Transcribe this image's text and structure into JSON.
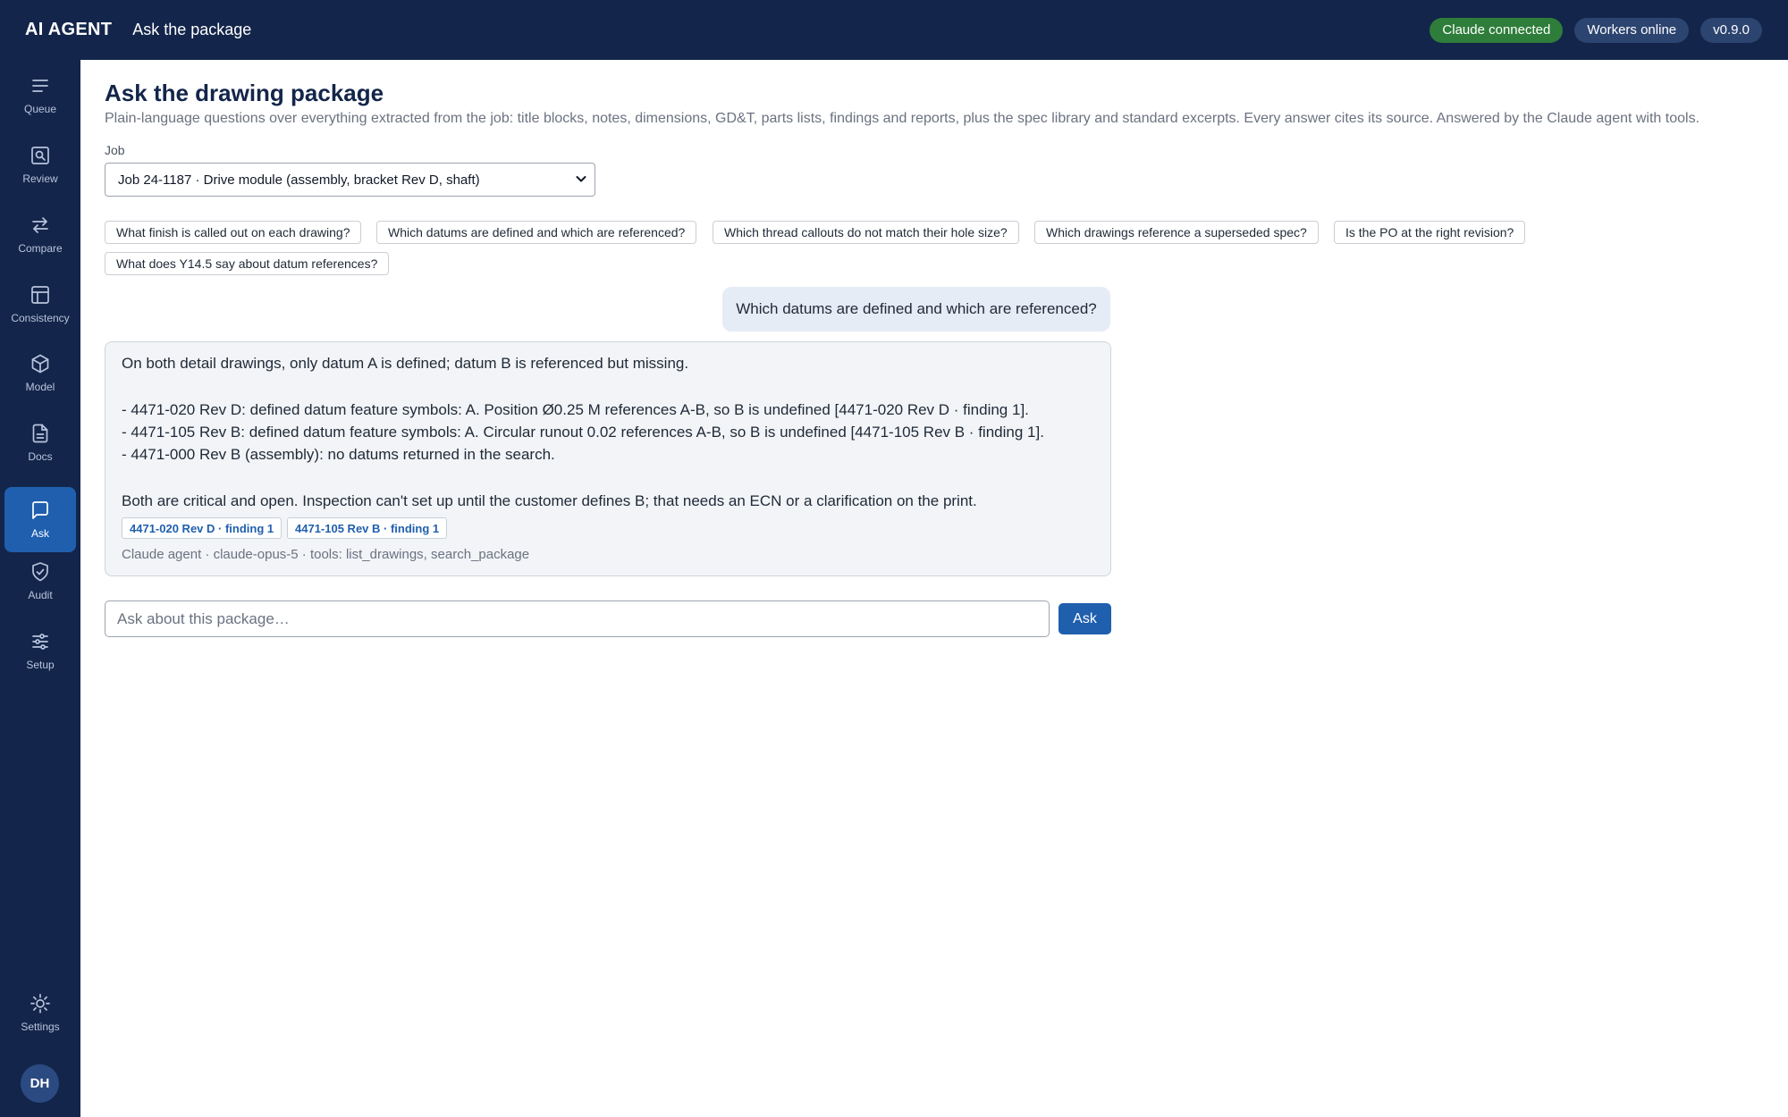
{
  "header": {
    "brand": "AI AGENT",
    "title": "Ask the package",
    "badges": [
      "Claude connected",
      "Workers online",
      "v0.9.0"
    ]
  },
  "sidebar": {
    "items": [
      {
        "label": "Queue",
        "icon": "list-icon"
      },
      {
        "label": "Review",
        "icon": "magnifier-document-icon"
      },
      {
        "label": "Compare",
        "icon": "swap-arrows-icon"
      },
      {
        "label": "Consistency",
        "icon": "table-icon"
      },
      {
        "label": "Model",
        "icon": "cube-icon"
      },
      {
        "label": "Docs",
        "icon": "document-icon"
      },
      {
        "label": "Ask",
        "icon": "chat-bubble-icon",
        "active": true
      },
      {
        "label": "Audit",
        "icon": "shield-check-icon"
      },
      {
        "label": "Setup",
        "icon": "sliders-icon"
      }
    ],
    "settings_label": "Settings",
    "avatar_initials": "DH"
  },
  "main": {
    "title": "Ask the drawing package",
    "description": "Plain-language questions over everything extracted from the job: title blocks, notes, dimensions, GD&T, parts lists, findings and reports, plus the spec library and standard excerpts. Every answer cites its source. Answered by the Claude agent with tools.",
    "job_label": "Job",
    "job_selected": "Job 24-1187 · Drive module (assembly, bracket Rev D, shaft)",
    "suggestions": [
      "What finish is called out on each drawing?",
      "Which datums are defined and which are referenced?",
      "Which thread callouts do not match their hole size?",
      "Which drawings reference a superseded spec?",
      "Is the PO at the right revision?",
      "What does Y14.5 say about datum references?"
    ],
    "user_question": "Which datums are defined and which are referenced?",
    "answer": {
      "lines": [
        "On both detail drawings, only datum A is defined; datum B is referenced but missing.",
        "- 4471-020 Rev D: defined datum feature symbols: A. Position Ø0.25 M references A-B, so B is undefined [4471-020 Rev D · finding 1].",
        "- 4471-105 Rev B: defined datum feature symbols: A. Circular runout 0.02 references A-B, so B is undefined [4471-105 Rev B · finding 1].",
        "- 4471-000 Rev B (assembly): no datums returned in the search.",
        "Both are critical and open. Inspection can't set up until the customer defines B; that needs an ECN or a clarification on the print."
      ],
      "citations": [
        "4471-020 Rev D · finding 1",
        "4471-105 Rev B · finding 1"
      ],
      "meta": "Claude agent · claude-opus-5 · tools: list_drawings, search_package"
    },
    "input_placeholder": "Ask about this package…",
    "ask_button": "Ask"
  }
}
